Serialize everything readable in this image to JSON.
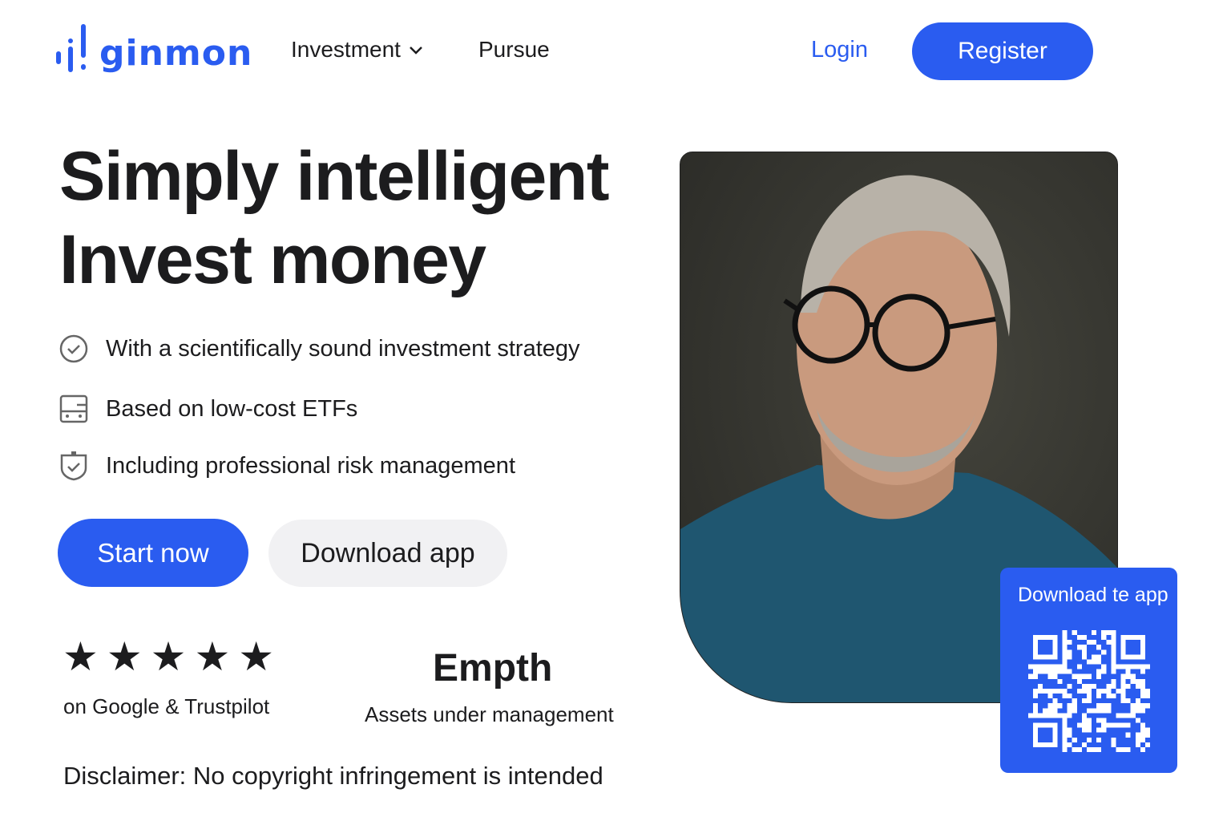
{
  "brand": {
    "name": "ginmon",
    "color": "#2a5cf0"
  },
  "nav": {
    "items": [
      {
        "label": "Investment",
        "has_dropdown": true
      },
      {
        "label": "Pursue"
      }
    ],
    "login": "Login",
    "register": "Register"
  },
  "hero": {
    "headline_line1": "Simply intelligent",
    "headline_line2": "Invest money",
    "features": [
      {
        "icon": "check-circle-icon",
        "text": "With a scientifically sound investment strategy"
      },
      {
        "icon": "wallet-icon",
        "text": "Based on low-cost ETFs"
      },
      {
        "icon": "shield-check-icon",
        "text": "Including professional risk management"
      }
    ],
    "start_button": "Start now",
    "download_button": "Download app"
  },
  "rating": {
    "stars": 5,
    "stars_text": "★★★★★",
    "label": "on Google & Trustpilot"
  },
  "aum": {
    "value": "Empth",
    "label": "Assets under management"
  },
  "disclaimer": "Disclaimer: No copyright infringement is intended",
  "qr_card": {
    "title": "Download te app"
  }
}
